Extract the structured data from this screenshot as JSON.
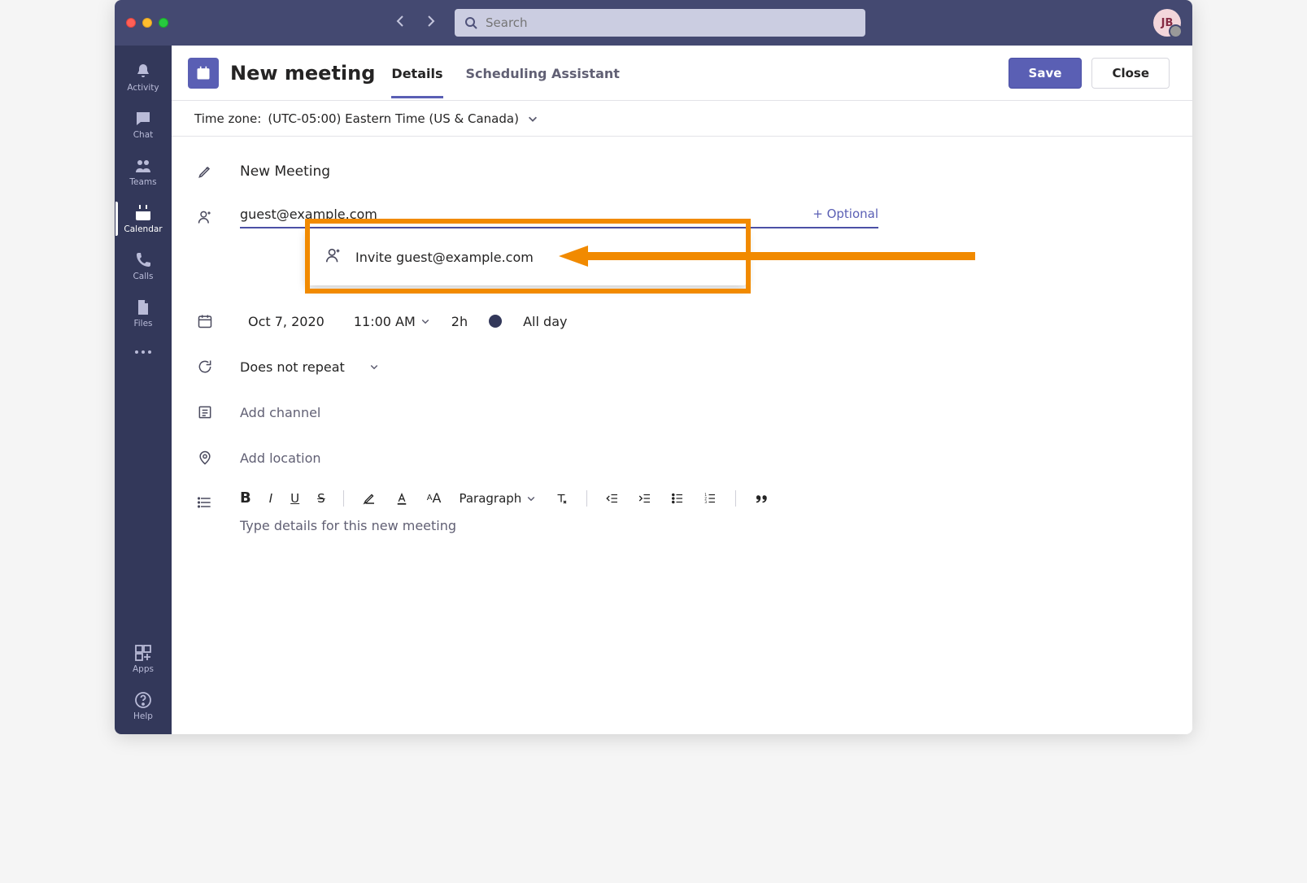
{
  "search": {
    "placeholder": "Search"
  },
  "avatar": "JB",
  "rail": {
    "items": [
      {
        "label": "Activity"
      },
      {
        "label": "Chat"
      },
      {
        "label": "Teams"
      },
      {
        "label": "Calendar"
      },
      {
        "label": "Calls"
      },
      {
        "label": "Files"
      }
    ],
    "bottom": [
      {
        "label": "Apps"
      },
      {
        "label": "Help"
      }
    ]
  },
  "header": {
    "title": "New meeting",
    "tabs": {
      "details": "Details",
      "scheduling": "Scheduling Assistant"
    },
    "save": "Save",
    "close": "Close"
  },
  "timezone": {
    "label": "Time zone:",
    "value": "(UTC-05:00) Eastern Time (US & Canada)"
  },
  "form": {
    "title": "New Meeting",
    "attendee": "guest@example.com",
    "optional": "+ Optional",
    "suggest": "Invite guest@example.com",
    "date": "Oct 7, 2020",
    "time": "11:00 AM",
    "duration": "2h",
    "allday": "All day",
    "recurrence": "Does not repeat",
    "channel_placeholder": "Add channel",
    "location_placeholder": "Add location",
    "paragraph": "Paragraph",
    "details_placeholder": "Type details for this new meeting"
  }
}
